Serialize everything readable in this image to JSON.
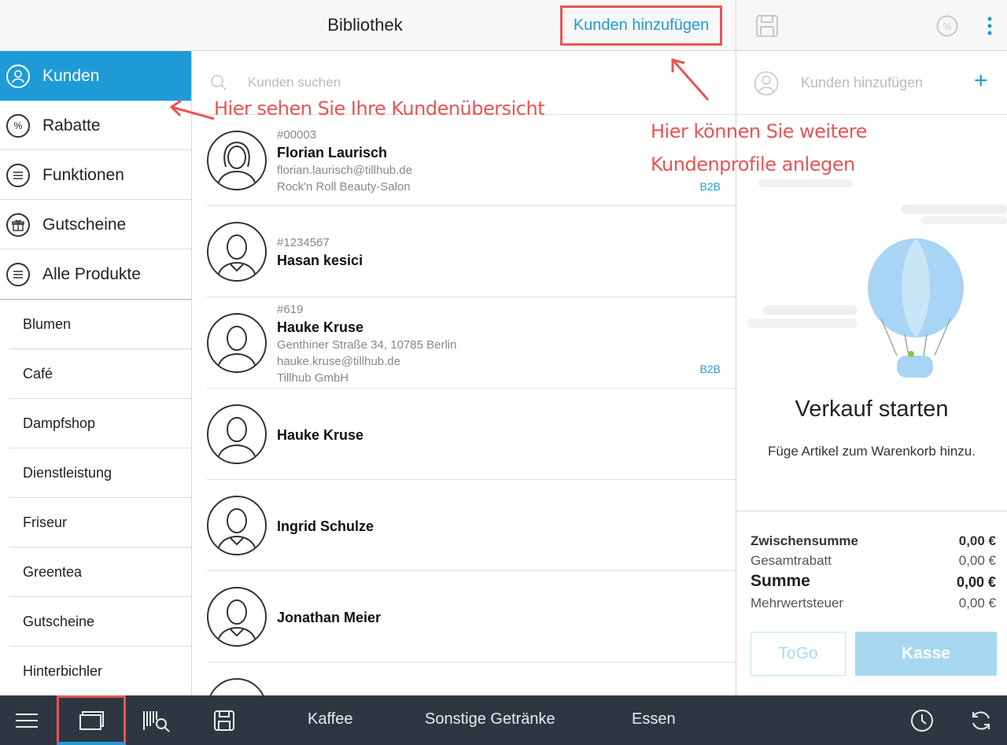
{
  "header": {
    "title": "Bibliothek",
    "add_customers_label": "Kunden hinzufügen"
  },
  "sidebar": {
    "items": [
      {
        "label": "Kunden",
        "icon": "user-circle-icon"
      },
      {
        "label": "Rabatte",
        "icon": "percent-circle-icon"
      },
      {
        "label": "Funktionen",
        "icon": "list-circle-icon"
      },
      {
        "label": "Gutscheine",
        "icon": "gift-circle-icon"
      },
      {
        "label": "Alle Produkte",
        "icon": "list-circle-icon"
      }
    ],
    "categories": [
      "Blumen",
      "Café",
      "Dampfshop",
      "Dienstleistung",
      "Friseur",
      "Greentea",
      "Gutscheine",
      "Hinterbichler"
    ]
  },
  "search": {
    "placeholder": "Kunden suchen"
  },
  "customers": [
    {
      "number": "#00003",
      "name": "Florian Laurisch",
      "line1": "florian.laurisch@tillhub.de",
      "line2": "Rock'n Roll Beauty-Salon",
      "tag": "B2B"
    },
    {
      "number": "#1234567",
      "name": "Hasan kesici"
    },
    {
      "number": "#619",
      "name": "Hauke Kruse",
      "line1": "Genthiner Straße 34, 10785 Berlin",
      "line2": "hauke.kruse@tillhub.de",
      "line3": "Tillhub GmbH",
      "tag": "B2B"
    },
    {
      "name": "Hauke Kruse"
    },
    {
      "name": "Ingrid Schulze"
    },
    {
      "name": "Jonathan Meier"
    }
  ],
  "cart": {
    "add_customer_placeholder": "Kunden hinzufügen",
    "empty_title": "Verkauf starten",
    "empty_subtitle": "Füge Artikel zum Warenkorb hinzu.",
    "totals": [
      {
        "label": "Zwischensumme",
        "value": "0,00 €"
      },
      {
        "label": "Gesamtrabatt",
        "value": "0,00 €"
      },
      {
        "label": "Summe",
        "value": "0,00 €"
      },
      {
        "label": "Mehrwertsteuer",
        "value": "0,00 €"
      }
    ],
    "togo_label": "ToGo",
    "checkout_label": "Kasse"
  },
  "bottombar": {
    "tabs": [
      "Kaffee",
      "Sonstige Getränke",
      "Essen"
    ]
  },
  "annotations": {
    "overview": "Hier sehen Sie Ihre Kundenübersicht",
    "create_line1": "Hier können Sie weitere",
    "create_line2": "Kundenprofile anlegen"
  },
  "colors": {
    "accent": "#1e9bd7",
    "annotation": "#e85454",
    "bottombar": "#2d3641"
  }
}
